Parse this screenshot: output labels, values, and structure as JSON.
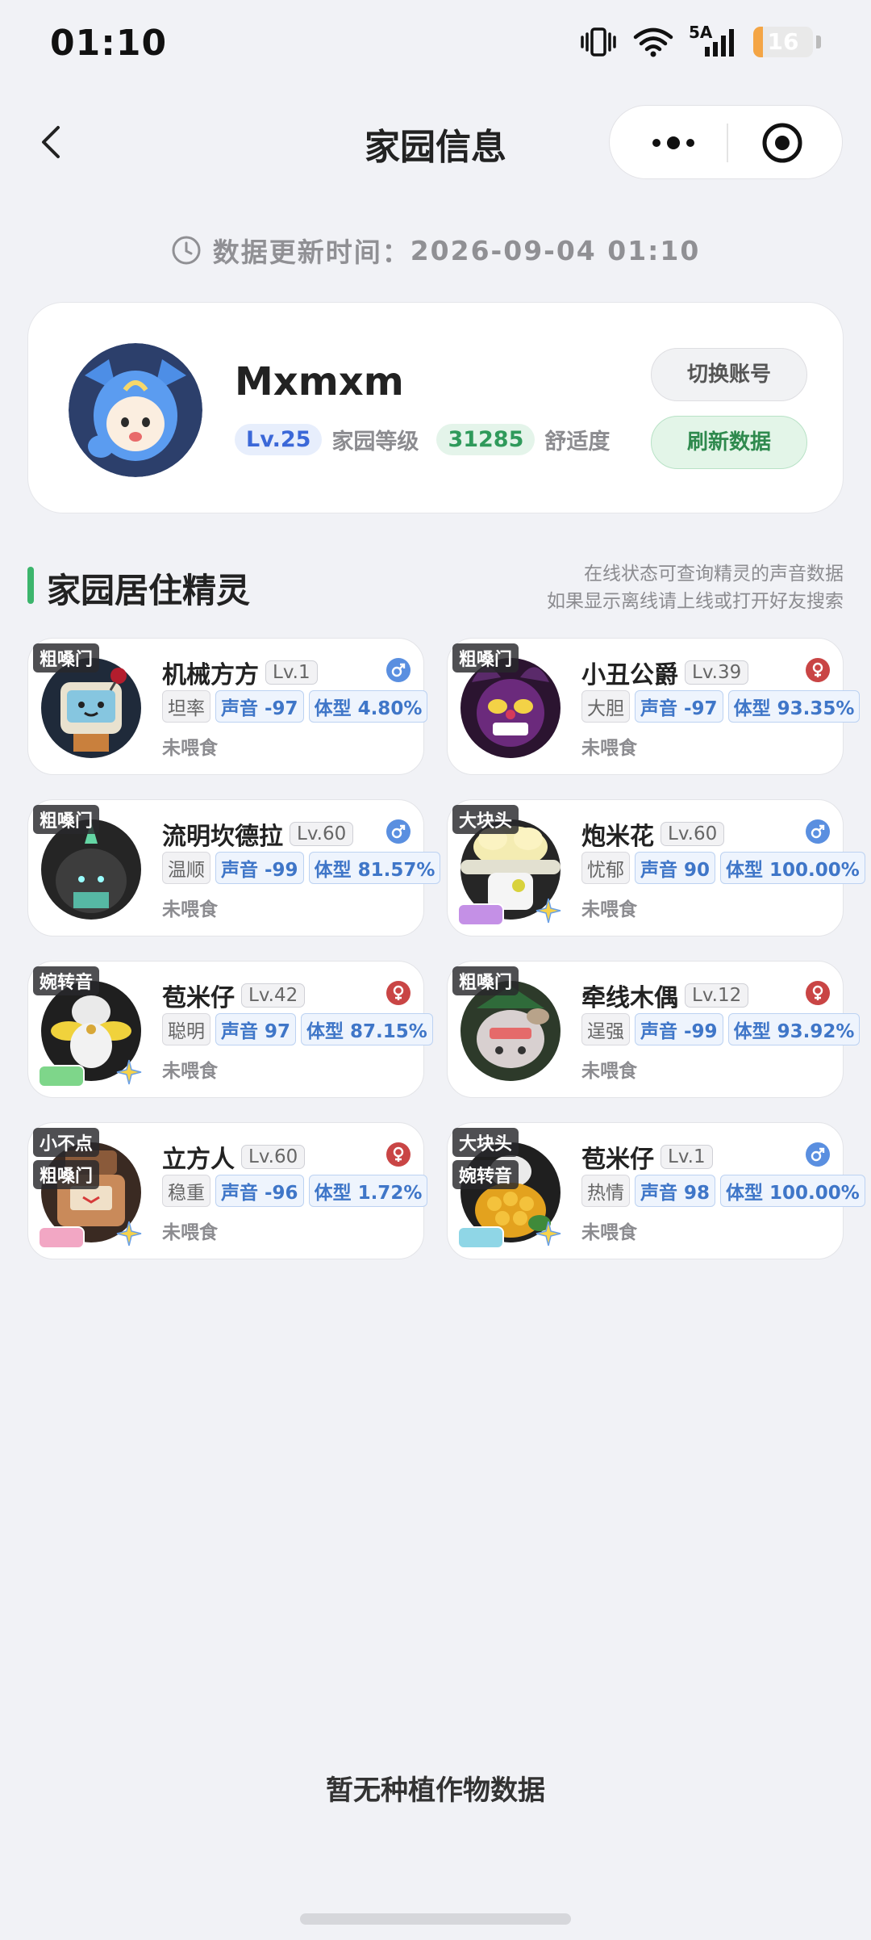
{
  "status_bar": {
    "time": "01:10",
    "network": "5A",
    "battery": "16",
    "battery_level": 0.16
  },
  "nav": {
    "title": "家园信息"
  },
  "update": {
    "label": "数据更新时间：",
    "time": "2026-09-04 01:10"
  },
  "profile": {
    "name": "Mxmxm",
    "level": "Lv.25",
    "level_label": "家园等级",
    "comfort": "31285",
    "comfort_label": "舒适度",
    "switch_label": "切换账号",
    "refresh_label": "刷新数据"
  },
  "section": {
    "title": "家园居住精灵",
    "hint_line1": "在线状态可查询精灵的声音数据",
    "hint_line2": "如果显示离线请上线或打开好友搜索"
  },
  "pets": [
    {
      "name": "机械方方",
      "level": "Lv.1",
      "gender": "male",
      "nature": "坦率",
      "sound": "声音 -97",
      "size": "体型 4.80%",
      "status": "未喂食",
      "tags": [
        "粗嗓门"
      ],
      "skill_color": "",
      "art": "robot"
    },
    {
      "name": "小丑公爵",
      "level": "Lv.39",
      "gender": "female",
      "nature": "大胆",
      "sound": "声音 -97",
      "size": "体型 93.35%",
      "status": "未喂食",
      "tags": [
        "粗嗓门"
      ],
      "skill_color": "",
      "art": "jester"
    },
    {
      "name": "流明坎德拉",
      "level": "Lv.60",
      "gender": "male",
      "nature": "温顺",
      "sound": "声音 -99",
      "size": "体型 81.57%",
      "status": "未喂食",
      "tags": [
        "粗嗓门"
      ],
      "skill_color": "",
      "art": "candle"
    },
    {
      "name": "炮米花",
      "level": "Lv.60",
      "gender": "male",
      "nature": "忧郁",
      "sound": "声音 90",
      "size": "体型 100.00%",
      "status": "未喂食",
      "tags": [
        "大块头"
      ],
      "skill_color": "#c490e6",
      "art": "popcorn"
    },
    {
      "name": "苞米仔",
      "level": "Lv.42",
      "gender": "female",
      "nature": "聪明",
      "sound": "声音 97",
      "size": "体型 87.15%",
      "status": "未喂食",
      "tags": [
        "婉转音"
      ],
      "skill_color": "#7ed68a",
      "art": "corn"
    },
    {
      "name": "牵线木偶",
      "level": "Lv.12",
      "gender": "female",
      "nature": "逞强",
      "sound": "声音 -99",
      "size": "体型 93.92%",
      "status": "未喂食",
      "tags": [
        "粗嗓门"
      ],
      "skill_color": "",
      "art": "puppet"
    },
    {
      "name": "立方人",
      "level": "Lv.60",
      "gender": "female",
      "nature": "稳重",
      "sound": "声音 -96",
      "size": "体型 1.72%",
      "status": "未喂食",
      "tags": [
        "小不点",
        "粗嗓门"
      ],
      "skill_color": "#f2a7c4",
      "art": "cube"
    },
    {
      "name": "苞米仔",
      "level": "Lv.1",
      "gender": "male",
      "nature": "热情",
      "sound": "声音 98",
      "size": "体型 100.00%",
      "status": "未喂食",
      "tags": [
        "大块头",
        "婉转音"
      ],
      "skill_color": "#8fd6e6",
      "art": "corn2"
    }
  ],
  "crops": {
    "empty_text": "暂无种植作物数据"
  },
  "colors": {
    "accent_green": "#3cb56c",
    "male": "#5a8fe0",
    "female": "#c94545"
  }
}
